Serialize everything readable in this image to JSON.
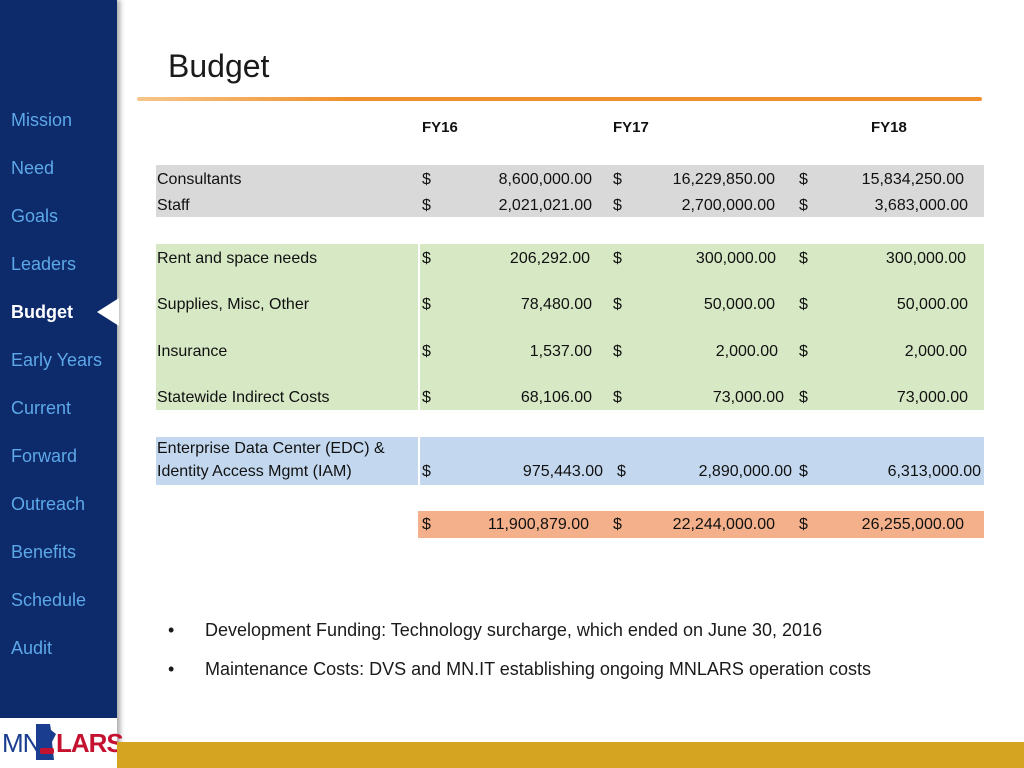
{
  "title": "Budget",
  "nav": [
    {
      "label": "Mission",
      "active": false
    },
    {
      "label": "Need",
      "active": false
    },
    {
      "label": "Goals",
      "active": false
    },
    {
      "label": "Leaders",
      "active": false
    },
    {
      "label": "Budget",
      "active": true
    },
    {
      "label": "Early Years",
      "active": false
    },
    {
      "label": "Current",
      "active": false
    },
    {
      "label": "Forward",
      "active": false
    },
    {
      "label": "Outreach",
      "active": false
    },
    {
      "label": "Benefits",
      "active": false
    },
    {
      "label": "Schedule",
      "active": false
    },
    {
      "label": "Audit",
      "active": false
    }
  ],
  "logo": {
    "mn": "MN",
    "lars": "LARS"
  },
  "table": {
    "headers": [
      "FY16",
      "FY17",
      "FY18"
    ],
    "currency": "$",
    "rows": [
      {
        "label": "Consultants",
        "values": [
          "8,600,000.00",
          "16,229,850.00",
          "15,834,250.00"
        ],
        "group": "gray"
      },
      {
        "label": "Staff",
        "values": [
          "2,021,021.00",
          "2,700,000.00",
          "3,683,000.00"
        ],
        "group": "gray"
      },
      {
        "label": "Rent and space needs",
        "values": [
          "206,292.00",
          "300,000.00",
          "300,000.00"
        ],
        "group": "green"
      },
      {
        "label": "Supplies, Misc, Other",
        "values": [
          "78,480.00",
          "50,000.00",
          "50,000.00"
        ],
        "group": "green"
      },
      {
        "label": "Insurance",
        "values": [
          "1,537.00",
          "2,000.00",
          "2,000.00"
        ],
        "group": "green"
      },
      {
        "label": "Statewide Indirect Costs",
        "values": [
          "68,106.00",
          "73,000.00",
          "73,000.00"
        ],
        "group": "green"
      },
      {
        "label_line1": "Enterprise Data Center (EDC) &",
        "label_line2": "Identity Access Mgmt (IAM)",
        "values": [
          "975,443.00",
          "2,890,000.00",
          "6,313,000.00"
        ],
        "group": "blue"
      }
    ],
    "totals": [
      "11,900,879.00",
      "22,244,000.00",
      "26,255,000.00"
    ],
    "colors": {
      "gray": "#d9d9d9",
      "green": "#d6e8c4",
      "blue": "#c3d8ee",
      "total": "#f4b08a"
    }
  },
  "bullets": [
    "Development Funding: Technology surcharge, which ended  on June 30, 2016",
    "Maintenance Costs: DVS and MN.IT establishing ongoing MNLARS operation costs"
  ],
  "bullet_glyph": "•"
}
